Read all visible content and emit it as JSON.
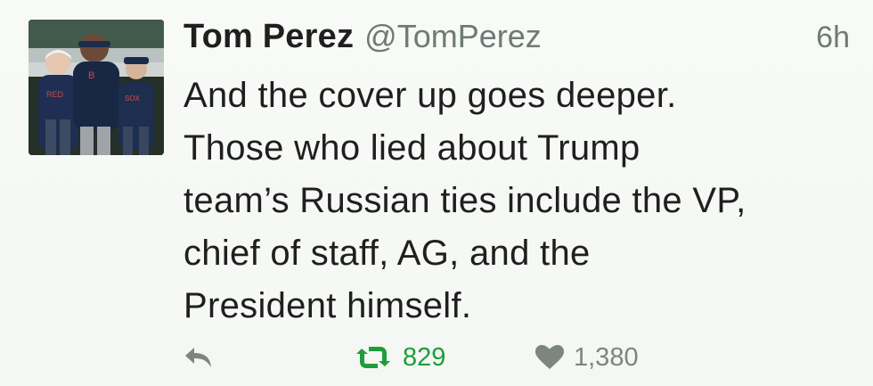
{
  "tweet": {
    "author": {
      "display_name": "Tom Perez",
      "handle": "@TomPerez"
    },
    "timestamp": "6h",
    "text": "And the cover up goes deeper.\nThose who lied about Trump\nteam’s Russian ties include the VP,\nchief of staff, AG, and the\nPresident himself.",
    "actions": {
      "reply_icon": "reply-icon",
      "retweet_icon": "retweet-icon",
      "retweet_count": "829",
      "like_icon": "heart-icon",
      "like_count": "1,380"
    },
    "colors": {
      "retweet_active": "#1f9d3d",
      "muted": "#7d8581",
      "text": "#1f1f1f"
    }
  }
}
